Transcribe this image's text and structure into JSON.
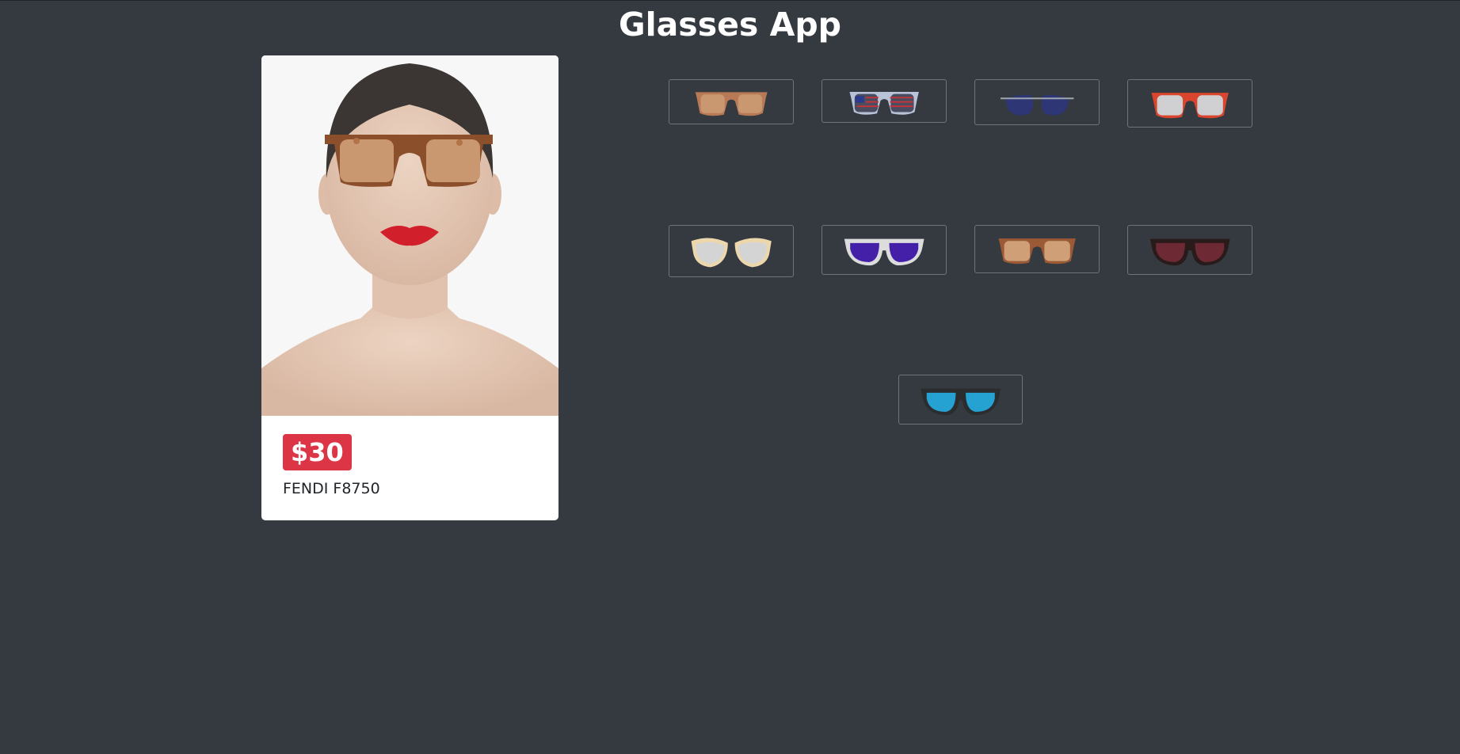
{
  "app": {
    "title": "Glasses App"
  },
  "product": {
    "price": "$30",
    "name": "FENDI F8750"
  },
  "glasses": [
    {
      "id": "brown-classic",
      "frame": "#b87a56",
      "lens": "#c99770",
      "style": "rect",
      "selected": false
    },
    {
      "id": "usa-flag",
      "frame": "#b8c3d8",
      "lens": "#4a4c60",
      "style": "flag",
      "selected": false
    },
    {
      "id": "blue-aviator",
      "frame": "#9ea5ad",
      "lens": "#2e3676",
      "style": "aviator",
      "selected": false
    },
    {
      "id": "red-frame",
      "frame": "#d9452d",
      "lens": "#d0d0d2",
      "style": "rect",
      "selected": false
    },
    {
      "id": "cream-cat-eye",
      "frame": "#ecd6ac",
      "lens": "#d4d4d4",
      "style": "cat",
      "selected": false
    },
    {
      "id": "white-purple",
      "frame": "#dcdcdc",
      "lens": "#4420a8",
      "style": "round",
      "selected": false
    },
    {
      "id": "tortoise-brown",
      "frame": "#9b5a35",
      "lens": "#cfa078",
      "style": "rect",
      "selected": true
    },
    {
      "id": "black-red-mirror",
      "frame": "#2a1b1b",
      "lens": "#6e2a34",
      "style": "round",
      "selected": false
    },
    {
      "id": "black-blue",
      "frame": "#2a2c2e",
      "lens": "#25a1d2",
      "style": "round",
      "selected": false
    }
  ],
  "colors": {
    "background": "#343a40",
    "badge": "#dc3545"
  }
}
